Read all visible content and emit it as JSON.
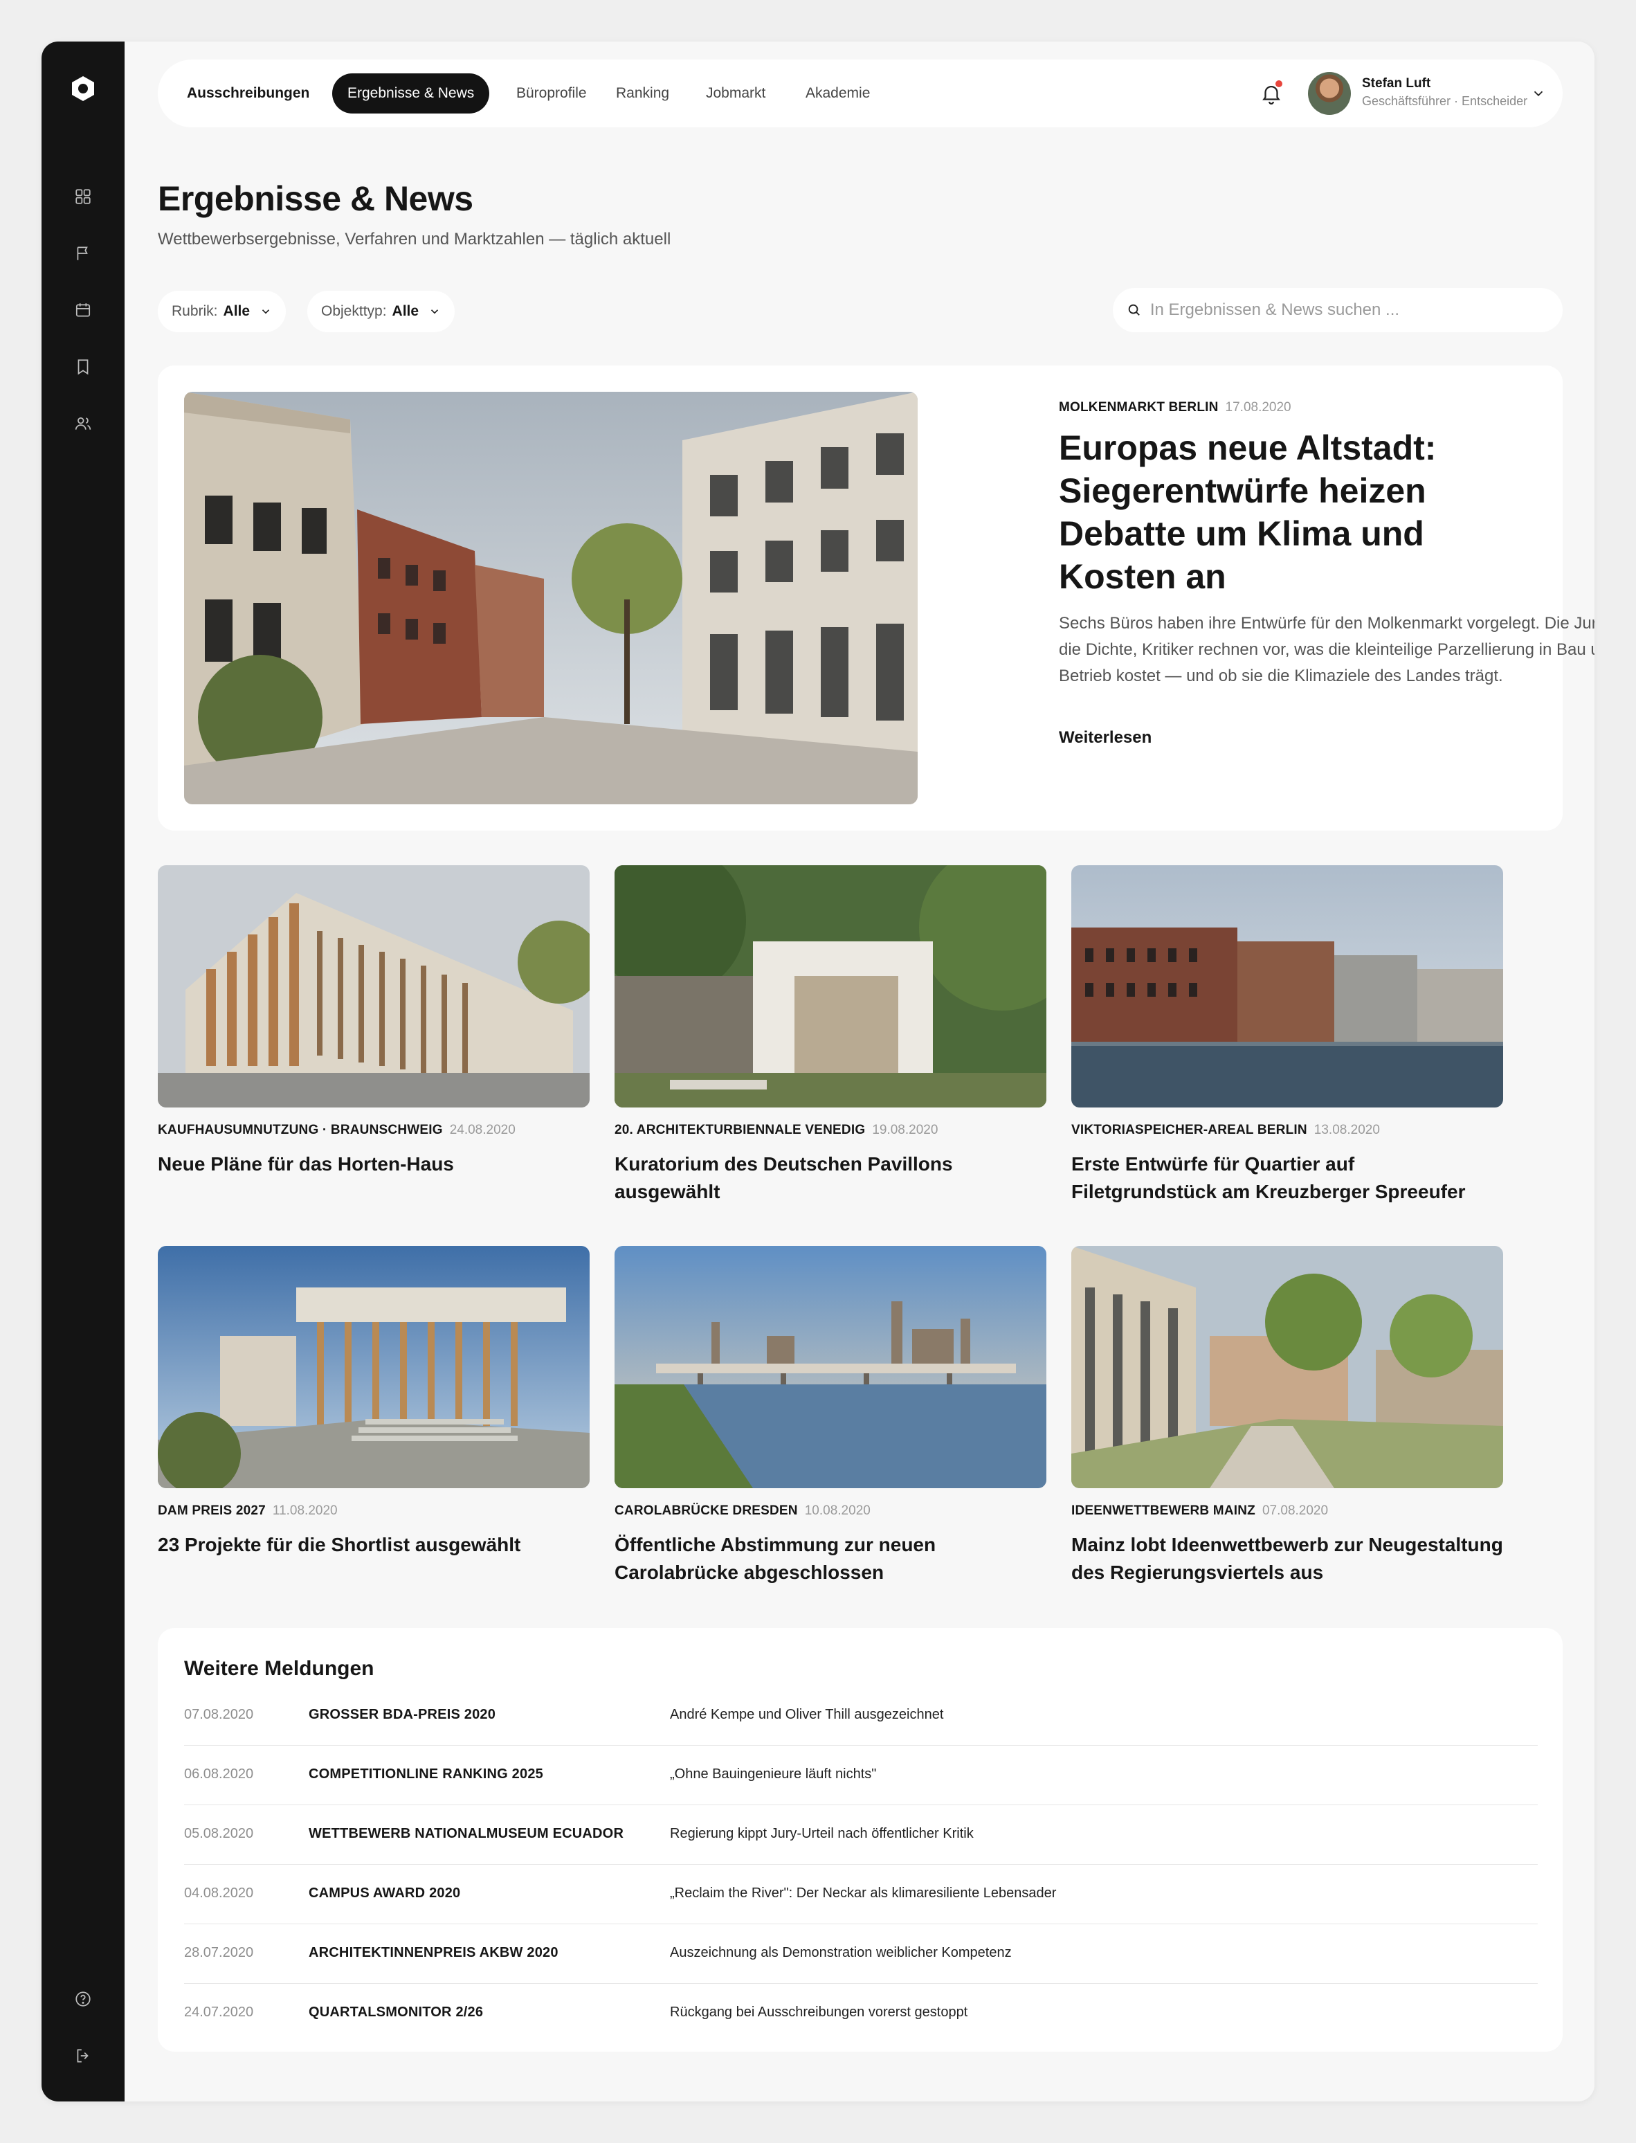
{
  "nav": {
    "items": [
      "Ausschreibungen",
      "Ergebnisse & News",
      "Büroprofile",
      "Ranking",
      "Jobmarkt",
      "Akademie"
    ],
    "active": "Ergebnisse & News"
  },
  "user": {
    "name": "Stefan Luft",
    "role": "Geschäftsführer · Entscheider"
  },
  "page": {
    "title": "Ergebnisse & News",
    "subtitle": "Wettbewerbsergebnisse, Verfahren und Marktzahlen — täglich aktuell"
  },
  "filters": {
    "rubrik": {
      "label": "Rubrik:",
      "value": "Alle"
    },
    "objekttyp": {
      "label": "Objekttyp:",
      "value": "Alle"
    },
    "search_placeholder": "In Ergebnissen & News suchen ..."
  },
  "featured": {
    "tag": "MOLKENMARKT BERLIN",
    "date": "17.08.2020",
    "title": "Europas neue Altstadt: Siegerentwürfe heizen Debatte um Klima und Kosten an",
    "text": "Sechs Büros haben ihre Entwürfe für den Molkenmarkt vorgelegt. Die Jury lobt die Dichte, Kritiker rechnen vor, was die kleinteilige Parzellierung in Bau und Betrieb kostet — und ob sie die Klimaziele des Landes trägt.",
    "more": "Weiterlesen"
  },
  "cards": [
    {
      "tag": "KAUFHAUSUMNUTZUNG · BRAUNSCHWEIG",
      "date": "24.08.2020",
      "title": "Neue Pläne für das Horten-Haus"
    },
    {
      "tag": "20. ARCHITEKTURBIENNALE VENEDIG",
      "date": "19.08.2020",
      "title": "Kuratorium des Deutschen Pavillons ausgewählt"
    },
    {
      "tag": "VIKTORIASPEICHER-AREAL BERLIN",
      "date": "13.08.2020",
      "title": "Erste Entwürfe für Quartier auf Filetgrundstück am Kreuzberger Spreeufer"
    },
    {
      "tag": "DAM PREIS 2027",
      "date": "11.08.2020",
      "title": "23 Projekte für die Shortlist ausgewählt"
    },
    {
      "tag": "CAROLABRÜCKE DRESDEN",
      "date": "10.08.2020",
      "title": "Öffentliche Abstimmung zur neuen Carolabrücke abgeschlossen"
    },
    {
      "tag": "IDEENWETTBEWERB MAINZ",
      "date": "07.08.2020",
      "title": "Mainz lobt Ideenwettbewerb zur Neugestaltung des Regierungsviertels aus"
    }
  ],
  "more_news": {
    "title": "Weitere Meldungen",
    "rows": [
      {
        "date": "07.08.2020",
        "tag": "GROSSER BDA-PREIS 2020",
        "text": "André Kempe und Oliver Thill ausgezeichnet"
      },
      {
        "date": "06.08.2020",
        "tag": "COMPETITIONLINE RANKING 2025",
        "text": "„Ohne Bauingenieure läuft nichts\""
      },
      {
        "date": "05.08.2020",
        "tag": "WETTBEWERB NATIONALMUSEUM ECUADOR",
        "text": "Regierung kippt Jury-Urteil nach öffentlicher Kritik"
      },
      {
        "date": "04.08.2020",
        "tag": "CAMPUS AWARD 2020",
        "text": "„Reclaim the River\": Der Neckar als klimaresiliente Lebensader"
      },
      {
        "date": "28.07.2020",
        "tag": "ARCHITEKTINNENPREIS AKBW 2020",
        "text": "Auszeichnung als Demonstration weiblicher Kompetenz"
      },
      {
        "date": "24.07.2020",
        "tag": "QUARTALSMONITOR 2/26",
        "text": "Rückgang bei Ausschreibungen vorerst gestoppt"
      }
    ]
  },
  "icons": {
    "sidebar": [
      "logo-icon",
      "dashboard-icon",
      "flag-icon",
      "calendar-icon",
      "bookmark-icon",
      "users-icon",
      "help-icon",
      "logout-icon"
    ],
    "header": [
      "bell-icon",
      "chevron-down-icon"
    ]
  },
  "colors": {
    "accent": "#131313",
    "notification": "#e8453c"
  }
}
